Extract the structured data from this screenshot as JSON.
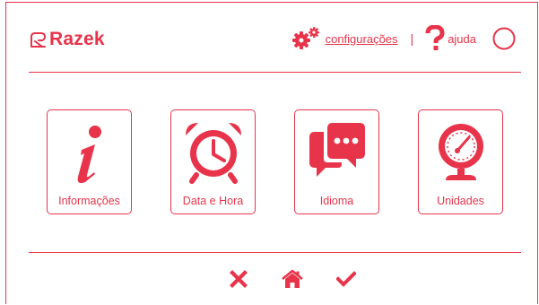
{
  "brand": {
    "name": "Razek"
  },
  "header": {
    "settings_label": "configurações",
    "separator": "|",
    "help_label": "ajuda"
  },
  "tiles": [
    {
      "label": "Informações",
      "icon": "info-icon"
    },
    {
      "label": "Data e Hora",
      "icon": "alarm-clock-icon"
    },
    {
      "label": "Idioma",
      "icon": "chat-bubbles-icon"
    },
    {
      "label": "Unidades",
      "icon": "gauge-icon"
    }
  ],
  "footer": {
    "buttons": [
      "close-icon",
      "home-icon",
      "check-icon"
    ]
  },
  "colors": {
    "accent": "#e8344a",
    "background": "#ffffff"
  }
}
